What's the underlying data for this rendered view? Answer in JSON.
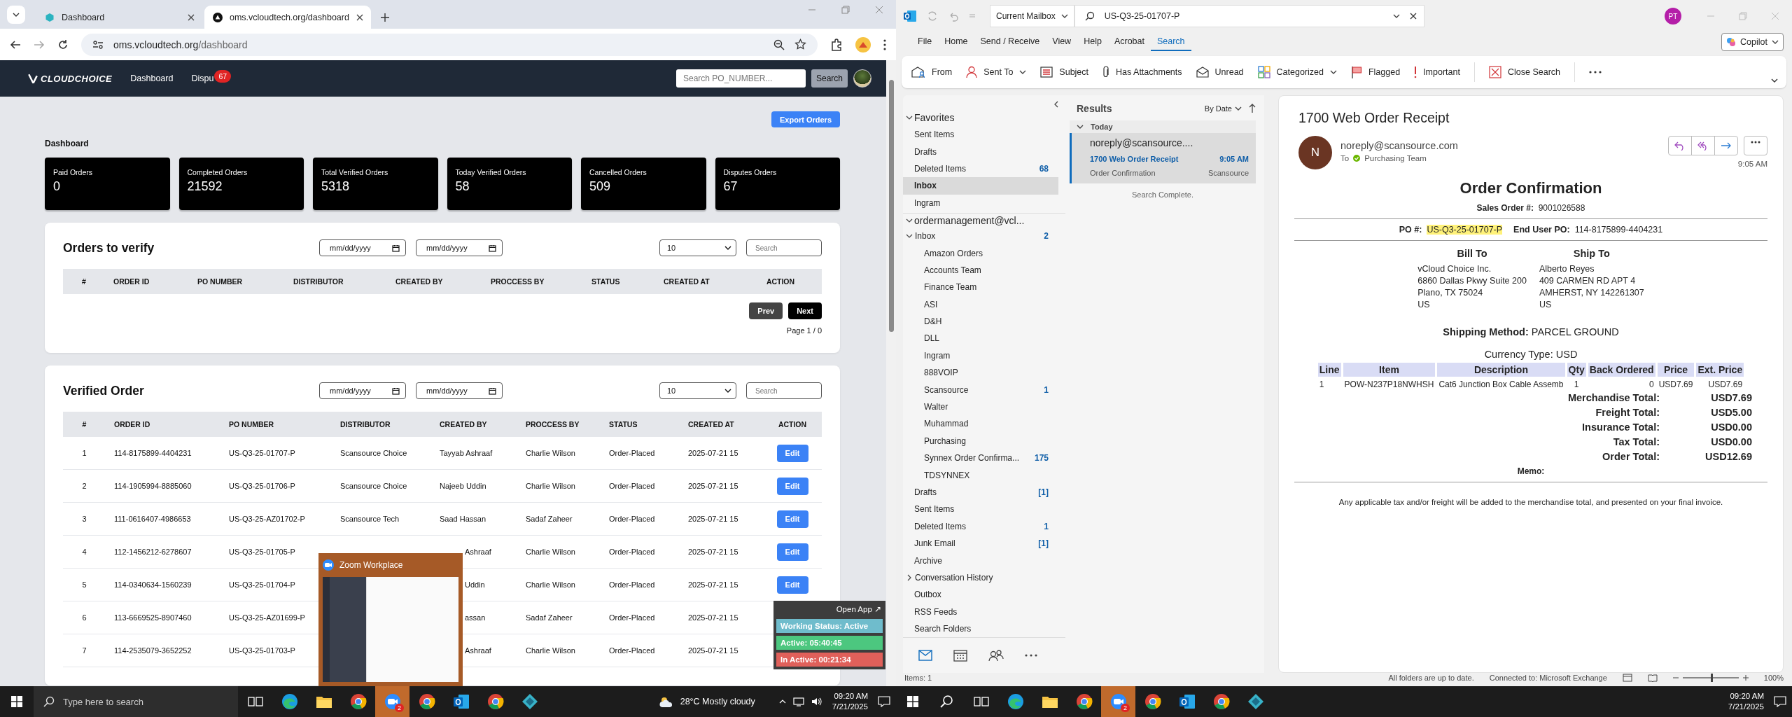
{
  "browser": {
    "tabs": [
      {
        "title": "Dashboard",
        "selected": false
      },
      {
        "title": "oms.vcloudtech.org/dashboard",
        "selected": true
      }
    ],
    "url_host": "oms.vcloudtech.org",
    "url_path": "/dashboard"
  },
  "oms": {
    "brand": "CLOUDCHOICE",
    "nav": [
      {
        "label": "Dashboard"
      },
      {
        "label": "Dispu",
        "badge": "67"
      }
    ],
    "search_placeholder": "Search PO_NUMBER...",
    "search_button": "Search",
    "export_button": "Export Orders",
    "heading": "Dashboard",
    "stats": [
      {
        "label": "Paid Orders",
        "value": "0"
      },
      {
        "label": "Completed Orders",
        "value": "21592"
      },
      {
        "label": "Total Verified Orders",
        "value": "5318"
      },
      {
        "label": "Today Verified Orders",
        "value": "58"
      },
      {
        "label": "Cancelled Orders",
        "value": "509"
      },
      {
        "label": "Disputes Orders",
        "value": "67"
      }
    ],
    "tables": [
      {
        "title": "Orders to verify",
        "date_placeholders": [
          "mm/dd/yyyy",
          "mm/dd/yyyy"
        ],
        "page_size": "10",
        "search_placeholder": "Search",
        "columns": [
          "#",
          "ORDER ID",
          "PO NUMBER",
          "DISTRIBUTOR",
          "CREATED BY",
          "PROCCESS BY",
          "STATUS",
          "CREATED AT",
          "ACTION"
        ],
        "pager": {
          "prev": "Prev",
          "next": "Next",
          "page": "Page 1 / 0"
        }
      },
      {
        "title": "Verified Order",
        "date_placeholders": [
          "mm/dd/yyyy",
          "mm/dd/yyyy"
        ],
        "page_size": "10",
        "search_placeholder": "Search",
        "columns": [
          "#",
          "ORDER ID",
          "PO NUMBER",
          "DISTRIBUTOR",
          "CREATED BY",
          "PROCCESS BY",
          "STATUS",
          "CREATED AT",
          "ACTION"
        ],
        "rows": [
          {
            "n": "1",
            "order_id": "114-8175899-4404231",
            "po": "US-Q3-25-01707-P",
            "distributor": "Scansource Choice",
            "created_by": "Tayyab Ashraaf",
            "process_by": "Charlie Wilson",
            "status": "Order-Placed",
            "created_at": "2025-07-21 15",
            "action": "Edit",
            "covered": false
          },
          {
            "n": "2",
            "order_id": "114-1905994-8885060",
            "po": "US-Q3-25-01706-P",
            "distributor": "Scansource Choice",
            "created_by": "Najeeb Uddin",
            "process_by": "Charlie Wilson",
            "status": "Order-Placed",
            "created_at": "2025-07-21 15",
            "action": "Edit",
            "covered": false
          },
          {
            "n": "3",
            "order_id": "111-0616407-4986653",
            "po": "US-Q3-25-AZ01702-P",
            "distributor": "Scansource Tech",
            "created_by": "Saad Hassan",
            "process_by": "Sadaf Zaheer",
            "status": "Order-Placed",
            "created_at": "2025-07-21 15",
            "action": "Edit",
            "covered": false
          },
          {
            "n": "4",
            "order_id": "112-1456212-6278607",
            "po": "US-Q3-25-01705-P",
            "created_by": "Ashraaf",
            "process_by": "Charlie Wilson",
            "status": "Order-Placed",
            "created_at": "2025-07-21 15",
            "action": "Edit",
            "covered": true
          },
          {
            "n": "5",
            "order_id": "114-0340634-1560239",
            "po": "US-Q3-25-01704-P",
            "created_by": "Uddin",
            "process_by": "Charlie Wilson",
            "status": "Order-Placed",
            "created_at": "2025-07-21 15",
            "action": "Edit",
            "covered": true
          },
          {
            "n": "6",
            "order_id": "113-6669525-8907460",
            "po": "US-Q3-25-AZ01699-P",
            "created_by": "assan",
            "process_by": "Sadaf Zaheer",
            "status": "Order-Placed",
            "created_at": "2025-07-21 15",
            "covered": true
          },
          {
            "n": "7",
            "order_id": "114-2535079-3652252",
            "po": "US-Q3-25-01703-P",
            "created_by": "Ashraaf",
            "process_by": "Charlie Wilson",
            "status": "Order-Placed",
            "created_at": "2025-07-21 15",
            "covered": true
          }
        ]
      }
    ]
  },
  "zoom_popup": {
    "title": "Zoom Workplace"
  },
  "status_widget": {
    "open_app": "Open App ↗",
    "lines": [
      {
        "text": "Working Status: Active",
        "color": "#6fbccc"
      },
      {
        "text": "Active: 05:40:45",
        "color": "#4cc77f"
      },
      {
        "text": "In Active: 00:21:34",
        "color": "#e0605a"
      }
    ]
  },
  "outlook": {
    "scope": "Current Mailbox",
    "search_query": "US-Q3-25-01707-P",
    "avatar": "PT",
    "copilot": "Copilot",
    "menu": [
      {
        "label": "File",
        "selected": false
      },
      {
        "label": "Home",
        "selected": false
      },
      {
        "label": "Send / Receive",
        "selected": false
      },
      {
        "label": "View",
        "selected": false
      },
      {
        "label": "Help",
        "selected": false
      },
      {
        "label": "Acrobat",
        "selected": false
      },
      {
        "label": "Search",
        "selected": true
      }
    ],
    "ribbon": [
      {
        "kind": "from",
        "label": "From"
      },
      {
        "kind": "sent_to",
        "label": "Sent To",
        "dropdown": true
      },
      {
        "kind": "subject",
        "label": "Subject"
      },
      {
        "kind": "attachments",
        "label": "Has Attachments"
      },
      {
        "kind": "unread",
        "label": "Unread"
      },
      {
        "kind": "categorized",
        "label": "Categorized",
        "dropdown": true
      },
      {
        "kind": "flagged",
        "label": "Flagged"
      },
      {
        "kind": "important",
        "label": "Important"
      },
      {
        "kind": "close_search",
        "label": "Close Search"
      }
    ],
    "folders": [
      {
        "title": "Favorites",
        "expanded": true,
        "items": [
          {
            "name": "Sent Items",
            "selected": false
          },
          {
            "name": "Drafts",
            "selected": false
          },
          {
            "name": "Deleted Items",
            "count": "68",
            "selected": false
          },
          {
            "name": "Inbox",
            "selected": true
          },
          {
            "name": "Ingram",
            "selected": false
          }
        ]
      },
      {
        "title": "ordermanagement@vcl...",
        "expanded": true,
        "items": [
          {
            "name": "Inbox",
            "count": "2",
            "selected": false,
            "expanded": true,
            "children": [
              {
                "name": "Amazon Orders",
                "selected": false
              },
              {
                "name": "Accounts Team",
                "selected": false
              },
              {
                "name": "Finance Team",
                "selected": false
              },
              {
                "name": "ASI",
                "selected": false
              },
              {
                "name": "D&H",
                "selected": false
              },
              {
                "name": "DLL",
                "selected": false
              },
              {
                "name": "Ingram",
                "selected": false
              },
              {
                "name": "888VOIP",
                "selected": false
              },
              {
                "name": "Scansource",
                "count": "1",
                "selected": false
              },
              {
                "name": "Walter",
                "selected": false
              },
              {
                "name": "Muhammad",
                "selected": false
              },
              {
                "name": "Purchasing",
                "selected": false
              },
              {
                "name": "Synnex Order Confirma...",
                "count": "175",
                "selected": false
              },
              {
                "name": "TDSYNNEX",
                "selected": false
              }
            ]
          },
          {
            "name": "Drafts",
            "count": "[1]",
            "selected": false
          },
          {
            "name": "Sent Items",
            "selected": false
          },
          {
            "name": "Deleted Items",
            "count": "1",
            "selected": false
          },
          {
            "name": "Junk Email",
            "count": "[1]",
            "selected": false
          },
          {
            "name": "Archive",
            "selected": false
          },
          {
            "name": "Conversation History",
            "selected": false,
            "expanded": false
          },
          {
            "name": "Outbox",
            "selected": false
          },
          {
            "name": "RSS Feeds",
            "selected": false
          },
          {
            "name": "Search Folders",
            "selected": false
          }
        ]
      }
    ],
    "results": {
      "title": "Results",
      "sort": "By Date",
      "group": "Today",
      "items": [
        {
          "sender": "noreply@scansource....",
          "subject": "1700 Web Order Receipt",
          "preview": "Order Confirmation",
          "time": "9:05 AM",
          "folder": "Scansource",
          "selected": true
        }
      ],
      "footer": "Search Complete."
    },
    "message": {
      "subject": "1700 Web Order Receipt",
      "avatar": "N",
      "from": "noreply@scansource.com",
      "to_label": "To",
      "to": "Purchasing Team",
      "time": "9:05 AM",
      "body": {
        "title": "Order Confirmation",
        "sales_order_label": "Sales Order #:",
        "sales_order": "9001026588",
        "refs": [
          {
            "label": "PO #:",
            "value": "US-Q3-25-01707-P",
            "highlighted": true
          },
          {
            "label": "End User PO:",
            "value": "114-8175899-4404231",
            "highlighted": false
          }
        ],
        "addresses": [
          {
            "heading": "Bill To",
            "lines": [
              "vCloud Choice Inc.",
              "6860 Dallas Pkwy Suite 200",
              "Plano, TX 75024",
              "US"
            ]
          },
          {
            "heading": "Ship To",
            "lines": [
              "Alberto Reyes",
              "409 CARMEN RD APT 4",
              "AMHERST, NY 142261307",
              "US"
            ]
          }
        ],
        "shipping_label": "Shipping Method:",
        "shipping": "PARCEL GROUND",
        "currency_label": "Currency Type:",
        "currency": "USD",
        "columns": [
          "Line",
          "Item",
          "Description",
          "Qty",
          "Back Ordered",
          "Price",
          "Ext. Price"
        ],
        "rows": [
          [
            "1",
            "POW-N237P18NWHSH",
            "Cat6 Junction Box Cable Assemb",
            "1",
            "0",
            "USD7.69",
            "USD7.69"
          ]
        ],
        "totals": [
          {
            "label": "Merchandise Total:",
            "value": "USD7.69"
          },
          {
            "label": "Freight Total:",
            "value": "USD5.00"
          },
          {
            "label": "Insurance Total:",
            "value": "USD0.00"
          },
          {
            "label": "Tax Total:",
            "value": "USD0.00"
          },
          {
            "label": "Order Total:",
            "value": "USD12.69"
          }
        ],
        "memo": "Memo:",
        "footer": "Any applicable tax and/or freight will be added to the merchandise total, and presented on your final invoice."
      }
    },
    "status": {
      "items": "Items: 1",
      "sync": "All folders are up to date.",
      "connection": "Connected to: Microsoft Exchange",
      "zoom": {
        "level": 0.5,
        "reading": "100%"
      }
    }
  },
  "taskbars": [
    {
      "search_placeholder": "Type here to search",
      "apps": [
        {
          "kind": "taskview",
          "active": false
        },
        {
          "kind": "edge",
          "active": false
        },
        {
          "kind": "explorer",
          "active": false
        },
        {
          "kind": "chrome",
          "active": false
        },
        {
          "kind": "zoom",
          "badge": "2",
          "active": true
        },
        {
          "kind": "chrome",
          "active": false
        },
        {
          "kind": "outlook",
          "active": false
        },
        {
          "kind": "chrome",
          "active": false
        },
        {
          "kind": "app",
          "active": false
        }
      ],
      "weather": "28°C Mostly cloudy",
      "time": "09:20 AM",
      "date": "7/21/2025"
    },
    {
      "apps": [
        {
          "kind": "search",
          "active": false
        },
        {
          "kind": "taskview",
          "active": false
        },
        {
          "kind": "edge",
          "active": false
        },
        {
          "kind": "explorer",
          "active": false
        },
        {
          "kind": "chrome",
          "active": false
        },
        {
          "kind": "zoom",
          "badge": "2",
          "active": true
        },
        {
          "kind": "chrome",
          "active": false
        },
        {
          "kind": "outlook",
          "active": false
        },
        {
          "kind": "chrome",
          "active": false
        },
        {
          "kind": "app",
          "active": false
        }
      ],
      "time": "09:20 AM",
      "date": "7/21/2025"
    }
  ]
}
